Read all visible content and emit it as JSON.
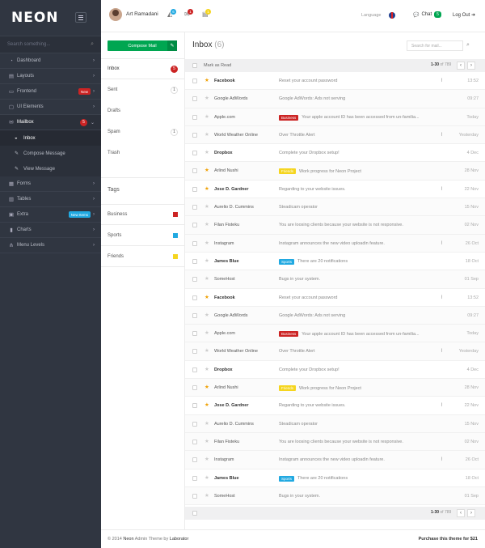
{
  "sidebar": {
    "logo": "NEON",
    "search_placeholder": "Search something...",
    "items": [
      {
        "label": "Dashboard",
        "icon": "gauge-icon",
        "glyph": "◔"
      },
      {
        "label": "Layouts",
        "icon": "layout-icon",
        "glyph": "▤"
      },
      {
        "label": "Frontend",
        "icon": "monitor-icon",
        "glyph": "▭",
        "badge": "New"
      },
      {
        "label": "UI Elements",
        "icon": "window-icon",
        "glyph": "▢"
      },
      {
        "label": "Mailbox",
        "icon": "mail-icon",
        "glyph": "✉",
        "count": "5"
      },
      {
        "label": "Forms",
        "icon": "forms-icon",
        "glyph": "▦"
      },
      {
        "label": "Tables",
        "icon": "table-icon",
        "glyph": "▥"
      },
      {
        "label": "Extra",
        "icon": "bag-icon",
        "glyph": "▣",
        "badge": "New Items"
      },
      {
        "label": "Charts",
        "icon": "chart-icon",
        "glyph": "▮"
      },
      {
        "label": "Menu Levels",
        "icon": "flow-icon",
        "glyph": "⋔"
      }
    ],
    "sub_items": [
      {
        "label": "Inbox",
        "icon": "inbox-icon",
        "glyph": "◒"
      },
      {
        "label": "Compose Message",
        "icon": "pencil-icon",
        "glyph": "✎"
      },
      {
        "label": "View Message",
        "icon": "pencil-icon",
        "glyph": "✎"
      }
    ]
  },
  "header": {
    "username": "Art Ramadani",
    "notif_counts": [
      "6",
      "1",
      "1"
    ],
    "language_label": "Language",
    "chat_label": "Chat",
    "chat_count": "5",
    "logout_label": "Log Out",
    "colors": {
      "blue": "#21a9e1",
      "red": "#cc2424",
      "yellow": "#f5d51f",
      "green": "#00a651"
    }
  },
  "mailnav": {
    "compose_label": "Compose Mail",
    "folders": [
      {
        "label": "Inbox",
        "count": "5"
      },
      {
        "label": "Sent",
        "count": "1"
      },
      {
        "label": "Drafts",
        "count": ""
      },
      {
        "label": "Spam",
        "count": "1"
      },
      {
        "label": "Trash",
        "count": ""
      }
    ],
    "tags_title": "Tags",
    "tags": [
      {
        "label": "Business",
        "color": "#cc2424"
      },
      {
        "label": "Sports",
        "color": "#21a9e1"
      },
      {
        "label": "Friends",
        "color": "#f5d51f"
      }
    ]
  },
  "mail": {
    "title": "Inbox",
    "count": "(6)",
    "search_placeholder": "Search for mail...",
    "mark_as_read": "Mark as Read",
    "pager_range": "1-30",
    "pager_of": "of 789",
    "rows": [
      {
        "sender": "Facebook",
        "subject": "Reset your account password",
        "tag": "",
        "tag_color": "",
        "date": "13:52",
        "starred": true,
        "unread": true,
        "attachment": true
      },
      {
        "sender": "Google AdWords",
        "subject": "Google AdWords: Ads not serving",
        "tag": "",
        "tag_color": "",
        "date": "09:27",
        "starred": false,
        "unread": false,
        "attachment": false
      },
      {
        "sender": "Apple.com",
        "subject": "Your apple account ID has been accessed from un-familia...",
        "tag": "Business",
        "tag_color": "red",
        "date": "Today",
        "starred": false,
        "unread": false,
        "attachment": false
      },
      {
        "sender": "World Weather Online",
        "subject": "Over Throttle Alert",
        "tag": "",
        "tag_color": "",
        "date": "Yesterday",
        "starred": false,
        "unread": false,
        "attachment": true
      },
      {
        "sender": "Dropbox",
        "subject": "Complete your Dropbox setup!",
        "tag": "",
        "tag_color": "",
        "date": "4 Dec",
        "starred": false,
        "unread": true,
        "attachment": false
      },
      {
        "sender": "Arlind Nushi",
        "subject": "Work progress for Neon Project",
        "tag": "Friends",
        "tag_color": "yellow",
        "date": "28 Nov",
        "starred": true,
        "unread": false,
        "attachment": false
      },
      {
        "sender": "Jose D. Gardner",
        "subject": "Regarding to your website issues.",
        "tag": "",
        "tag_color": "",
        "date": "22 Nov",
        "starred": true,
        "unread": true,
        "attachment": true
      },
      {
        "sender": "Aurelio D. Cummins",
        "subject": "Steadicam operator",
        "tag": "",
        "tag_color": "",
        "date": "15 Nov",
        "starred": false,
        "unread": false,
        "attachment": false
      },
      {
        "sender": "Filan Fisteku",
        "subject": "You are loosing clients because your website is not responsive.",
        "tag": "",
        "tag_color": "",
        "date": "02 Nov",
        "starred": false,
        "unread": false,
        "attachment": false
      },
      {
        "sender": "Instagram",
        "subject": "Instagram announces the new video uploadin feature.",
        "tag": "",
        "tag_color": "",
        "date": "26 Oct",
        "starred": false,
        "unread": false,
        "attachment": true
      },
      {
        "sender": "James Blue",
        "subject": "There are 20 notifications",
        "tag": "Sports",
        "tag_color": "blue",
        "date": "18 Oct",
        "starred": false,
        "unread": true,
        "attachment": false
      },
      {
        "sender": "SomeHost",
        "subject": "Bugs in your system.",
        "tag": "",
        "tag_color": "",
        "date": "01 Sep",
        "starred": false,
        "unread": false,
        "attachment": false
      },
      {
        "sender": "Facebook",
        "subject": "Reset your account password",
        "tag": "",
        "tag_color": "",
        "date": "13:52",
        "starred": true,
        "unread": true,
        "attachment": true
      },
      {
        "sender": "Google AdWords",
        "subject": "Google AdWords: Ads not serving",
        "tag": "",
        "tag_color": "",
        "date": "09:27",
        "starred": false,
        "unread": false,
        "attachment": false
      },
      {
        "sender": "Apple.com",
        "subject": "Your apple account ID has been accessed from un-familia...",
        "tag": "Business",
        "tag_color": "red",
        "date": "Today",
        "starred": false,
        "unread": false,
        "attachment": false
      },
      {
        "sender": "World Weather Online",
        "subject": "Over Throttle Alert",
        "tag": "",
        "tag_color": "",
        "date": "Yesterday",
        "starred": false,
        "unread": false,
        "attachment": true
      },
      {
        "sender": "Dropbox",
        "subject": "Complete your Dropbox setup!",
        "tag": "",
        "tag_color": "",
        "date": "4 Dec",
        "starred": false,
        "unread": true,
        "attachment": false
      },
      {
        "sender": "Arlind Nushi",
        "subject": "Work progress for Neon Project",
        "tag": "Friends",
        "tag_color": "yellow",
        "date": "28 Nov",
        "starred": true,
        "unread": false,
        "attachment": false
      },
      {
        "sender": "Jose D. Gardner",
        "subject": "Regarding to your website issues.",
        "tag": "",
        "tag_color": "",
        "date": "22 Nov",
        "starred": true,
        "unread": true,
        "attachment": true
      },
      {
        "sender": "Aurelio D. Cummins",
        "subject": "Steadicam operator",
        "tag": "",
        "tag_color": "",
        "date": "15 Nov",
        "starred": false,
        "unread": false,
        "attachment": false
      },
      {
        "sender": "Filan Fisteku",
        "subject": "You are loosing clients because your website is not responsive.",
        "tag": "",
        "tag_color": "",
        "date": "02 Nov",
        "starred": false,
        "unread": false,
        "attachment": false
      },
      {
        "sender": "Instagram",
        "subject": "Instagram announces the new video uploadin feature.",
        "tag": "",
        "tag_color": "",
        "date": "26 Oct",
        "starred": false,
        "unread": false,
        "attachment": true
      },
      {
        "sender": "James Blue",
        "subject": "There are 20 notifications",
        "tag": "Sports",
        "tag_color": "blue",
        "date": "18 Oct",
        "starred": false,
        "unread": true,
        "attachment": false
      },
      {
        "sender": "SomeHost",
        "subject": "Bugs in your system.",
        "tag": "",
        "tag_color": "",
        "date": "01 Sep",
        "starred": false,
        "unread": false,
        "attachment": false
      }
    ]
  },
  "footer": {
    "copy_prefix": "© 2014",
    "brand": "Neon",
    "copy_mid": "Admin Theme by",
    "author": "Laborator",
    "buy": "Purchase this theme for $21"
  }
}
